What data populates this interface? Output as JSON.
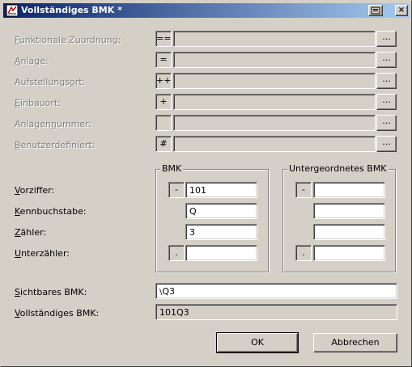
{
  "window": {
    "title": "Vollständiges BMK *",
    "help_glyph": "▤",
    "close_glyph": "×"
  },
  "rows": [
    {
      "label": "Funktionale Zuordnung:",
      "mnemonic": "F",
      "rest": "unktionale Zuordnung:",
      "prefix": "==",
      "value": "",
      "button": "..."
    },
    {
      "label": "Anlage:",
      "mnemonic": "A",
      "rest": "nlage:",
      "prefix": "=",
      "value": "",
      "button": "..."
    },
    {
      "label": "Aufstellungsort:",
      "mnemonic_pre": "Aufstellungs",
      "mnemonic": "o",
      "rest": "rt:",
      "prefix": "++",
      "value": "",
      "button": "..."
    },
    {
      "label": "Einbauort:",
      "mnemonic": "E",
      "rest": "inbauort:",
      "prefix": "+",
      "value": "",
      "button": "..."
    },
    {
      "label": "Anlagennummer:",
      "mnemonic_pre": "Anlagen",
      "mnemonic": "n",
      "rest": "ummer:",
      "prefix": "",
      "value": "",
      "button": "..."
    },
    {
      "label": "Benutzerdefiniert:",
      "mnemonic": "B",
      "rest": "enutzerdefiniert:",
      "prefix": "#",
      "value": "",
      "button": "..."
    }
  ],
  "bmk_group": {
    "title": "BMK",
    "vorziffer_prefix": "-",
    "vorziffer": "101",
    "kennbuchstabe": "Q",
    "zaehler": "3",
    "unterzaehler_prefix": ".",
    "unterzaehler": ""
  },
  "sub_group": {
    "title": "Untergeordnetes BMK",
    "vorziffer_prefix": "-",
    "vorziffer": "",
    "kennbuchstabe": "",
    "zaehler": "",
    "unterzaehler_prefix": ".",
    "unterzaehler": ""
  },
  "fields": {
    "vorziffer": {
      "mnemonic": "V",
      "rest": "orziffer:"
    },
    "kennbuchstabe": {
      "mnemonic": "K",
      "rest": "ennbuchstabe:"
    },
    "zaehler": {
      "mnemonic": "Z",
      "rest": "ähler:"
    },
    "unterzaehler": {
      "mnemonic": "U",
      "rest": "nterzähler:"
    }
  },
  "sichtbares": {
    "mnemonic": "S",
    "rest": "ichtbares BMK:",
    "value": "Q3",
    "marker": "\\"
  },
  "vollstaendiges": {
    "mnemonic": "V",
    "rest": "ollständiges BMK:",
    "value": "101Q3"
  },
  "buttons": {
    "ok": "OK",
    "cancel": "Abbrechen"
  }
}
